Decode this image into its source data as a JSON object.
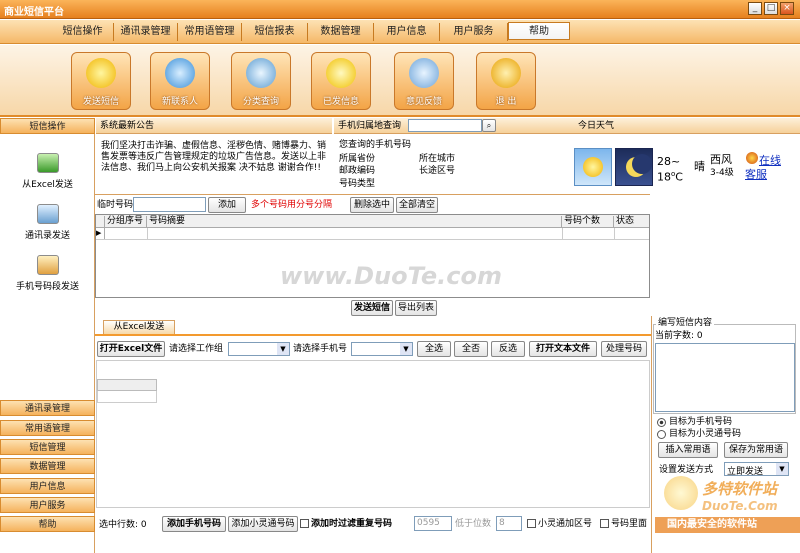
{
  "window": {
    "title": "商业短信平台",
    "min": "_",
    "max": "□",
    "close": "×"
  },
  "menu": [
    "短信操作",
    "通讯录管理",
    "常用语管理",
    "短信报表",
    "数据管理",
    "用户信息",
    "用户服务",
    "帮助"
  ],
  "toolbar": [
    "发送短信",
    "新联系人",
    "分类查询",
    "已发信息",
    "意见反馈",
    "退 出"
  ],
  "left": {
    "header": "短信操作",
    "items": [
      "从Excel发送",
      "通讯录发送",
      "手机号码段发送"
    ],
    "nav": [
      "通讯录管理",
      "常用语管理",
      "短信管理",
      "数据管理",
      "用户信息",
      "用户服务",
      "帮助"
    ]
  },
  "notice": {
    "title": "系统最新公告",
    "text": "我们坚决打击诈骗、虚假信息、淫秽色情、赌博暴力、销售发票等违反广告管理规定的垃圾广告信息。发送以上非法信息、我们马上向公安机关报案 决不姑息 谢谢合作!!"
  },
  "lookup": {
    "title": "手机归属地查询",
    "query_label": "您查询的手机号码",
    "province": "所属省份",
    "city": "所在城市",
    "zip": "邮政编码",
    "area": "长途区号",
    "type": "号码类型"
  },
  "weather": {
    "title": "今日天气",
    "temp_high": "28~",
    "temp_low": "18",
    "temp_unit": "C",
    "condition": "晴",
    "wind": "西风",
    "wind_level": "3-4级",
    "service": "在线客服"
  },
  "numbers": {
    "label": "临时号码",
    "input": "",
    "add": "添加",
    "hint": "多个号码用分号分隔",
    "delete_selected": "删除选中",
    "clear_all": "全部清空",
    "columns": [
      "分组序号",
      "号码摘要",
      "号码个数",
      "状态"
    ],
    "row_marker": "▶",
    "send": "发送短信",
    "export": "导出列表"
  },
  "excel": {
    "tab": "从Excel发送",
    "open": "打开Excel文件",
    "sheet_label": "请选择工作组",
    "phone_label": "请选择手机号",
    "select_all": "全选",
    "select_none": "全否",
    "invert": "反选",
    "open_text": "打开文本文件",
    "process": "处理号码",
    "selected_rows_label": "选中行数",
    "selected_rows": "0",
    "add_phone": "添加手机号码",
    "add_xlt": "添加小灵通号码",
    "filter_dup": "添加时过滤重复号码",
    "prefix": "0595",
    "digits_label": "位数",
    "digits_prefix": "低于",
    "digits": "8",
    "xlt_area": "小灵通加区号",
    "phone_in": "号码里面"
  },
  "compose": {
    "title": "编写短信内容",
    "count_label": "当前字数",
    "count": "0",
    "target_phone": "目标为手机号码",
    "target_xlt": "目标为小灵通号码",
    "insert_phrase": "插入常用语",
    "save_phrase": "保存为常用语",
    "mode_label": "设置发送方式",
    "mode": "立即发送"
  },
  "watermark": {
    "site": "www.DuoTe.com",
    "brand": "多特软件站",
    "slogan": "国内最安全的软件站",
    "brand_url": "DuoTe.Com"
  },
  "colors": {
    "accent": "#f39a2e",
    "title": "#e6801e",
    "hint": "#e00000"
  }
}
